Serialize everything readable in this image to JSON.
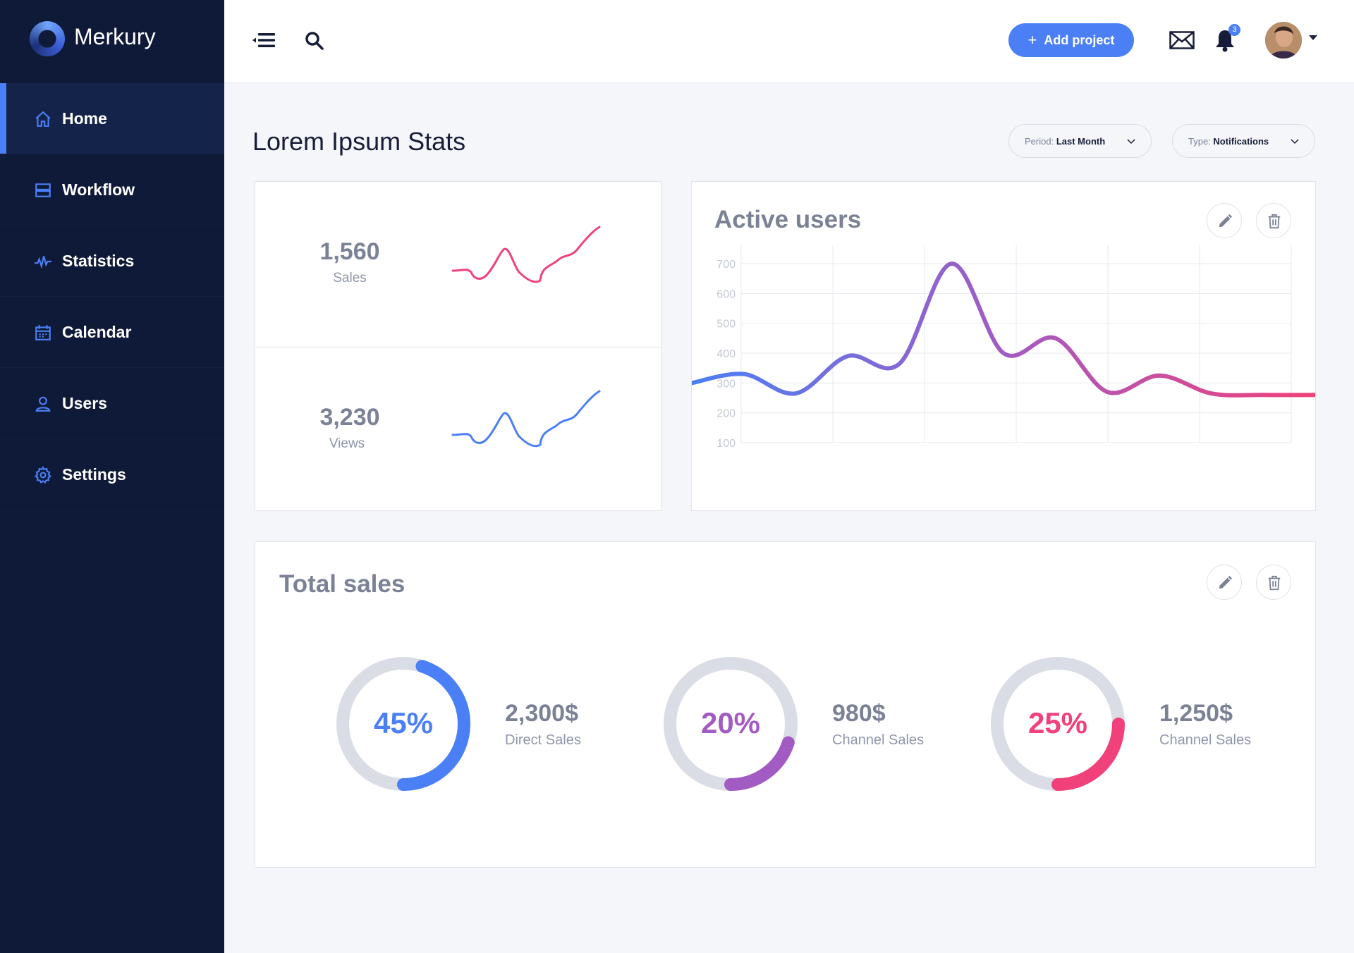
{
  "brand": {
    "name": "Merkury"
  },
  "sidebar": {
    "items": [
      {
        "label": "Home",
        "icon": "home-icon",
        "active": true
      },
      {
        "label": "Workflow",
        "icon": "layers-icon",
        "active": false
      },
      {
        "label": "Statistics",
        "icon": "pulse-icon",
        "active": false
      },
      {
        "label": "Calendar",
        "icon": "calendar-icon",
        "active": false
      },
      {
        "label": "Users",
        "icon": "user-icon",
        "active": false
      },
      {
        "label": "Settings",
        "icon": "gear-icon",
        "active": false
      }
    ]
  },
  "topbar": {
    "add_project_label": "Add project",
    "notification_count": "3"
  },
  "page": {
    "title": "Lorem Ipsum Stats",
    "filters": [
      {
        "label": "Period:",
        "value": "Last Month"
      },
      {
        "label": "Type:",
        "value": "Notifications"
      }
    ]
  },
  "stats": [
    {
      "value": "1,560",
      "label": "Sales",
      "color": "#f0417a"
    },
    {
      "value": "3,230",
      "label": "Views",
      "color": "#4a7ff5"
    }
  ],
  "active_users": {
    "title": "Active users",
    "chart_data": {
      "type": "line",
      "ylim": [
        100,
        700
      ],
      "y_ticks": [
        100,
        200,
        300,
        400,
        500,
        600,
        700
      ],
      "grid": true,
      "gradient": [
        "#4a7ff5",
        "#a35bc4",
        "#f0417a"
      ],
      "x": [
        0,
        1,
        2,
        3,
        4,
        5,
        6,
        7,
        8,
        9,
        10,
        11,
        12
      ],
      "values": [
        300,
        330,
        265,
        390,
        365,
        700,
        400,
        450,
        270,
        325,
        265,
        260,
        260
      ]
    }
  },
  "total_sales": {
    "title": "Total sales",
    "donuts": [
      {
        "percent": 45,
        "percent_label": "45%",
        "amount": "2,300$",
        "label": "Direct Sales",
        "color": "#4a7ff5"
      },
      {
        "percent": 20,
        "percent_label": "20%",
        "amount": "980$",
        "label": "Channel Sales",
        "color": "#a35bc4"
      },
      {
        "percent": 25,
        "percent_label": "25%",
        "amount": "1,250$",
        "label": "Channel Sales",
        "color": "#f0417a"
      }
    ]
  }
}
